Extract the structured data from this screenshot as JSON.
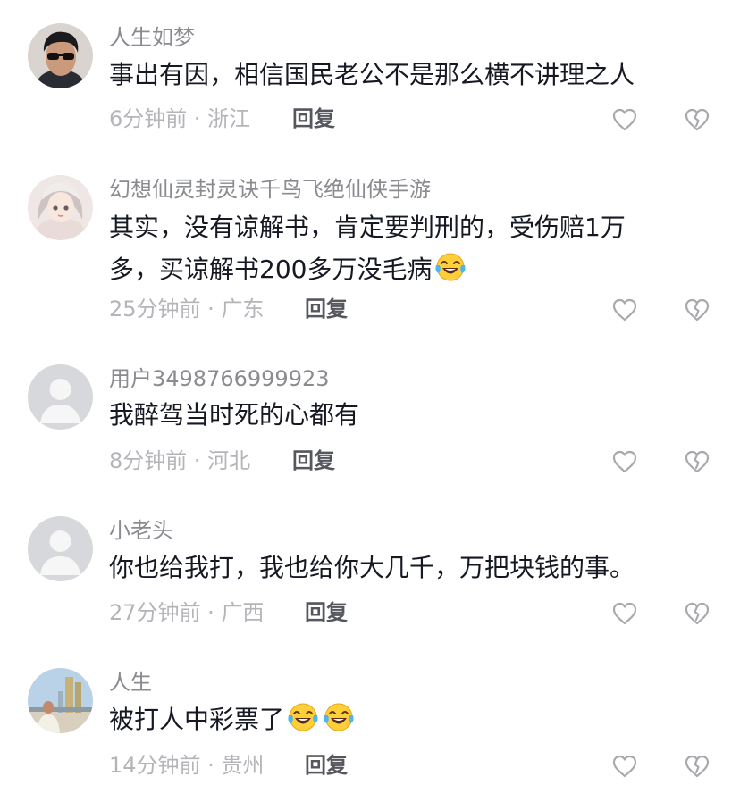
{
  "comments": [
    {
      "username": "人生如梦",
      "content": "事出有因，相信国民老公不是那么横不讲理之人",
      "time": "6分钟前",
      "location": "浙江",
      "reply_label": "回复",
      "avatar_icon": "man-sunglasses-avatar",
      "emojis": []
    },
    {
      "username": "幻想仙灵封灵诀千鸟飞绝仙侠手游",
      "content_line1": "其实，没有谅解书，肯定要判刑的，受伤赔1万",
      "content_line2": "多，买谅解书200多万没毛病",
      "time": "25分钟前",
      "location": "广东",
      "reply_label": "回复",
      "avatar_icon": "anime-girl-avatar",
      "emojis": [
        "laughing-tears-emoji"
      ]
    },
    {
      "username": "用户3498766999923",
      "content": "我醉驾当时死的心都有",
      "time": "8分钟前",
      "location": "河北",
      "reply_label": "回复",
      "avatar_icon": "default-user-avatar",
      "emojis": []
    },
    {
      "username": "小老头",
      "content": "你也给我打，我也给你大几千，万把块钱的事。",
      "time": "27分钟前",
      "location": "广西",
      "reply_label": "回复",
      "avatar_icon": "default-user-avatar",
      "emojis": []
    },
    {
      "username": "人生",
      "content": "被打人中彩票了",
      "time": "14分钟前",
      "location": "贵州",
      "reply_label": "回复",
      "avatar_icon": "city-photo-avatar",
      "emojis": [
        "laughing-tears-emoji",
        "laughing-tears-emoji"
      ]
    }
  ],
  "meta_separator": " · ",
  "icons": {
    "like": "heart-outline-icon",
    "dislike": "broken-heart-icon"
  },
  "colors": {
    "username": "#8a8b91",
    "content": "#161823",
    "meta": "#b4b5b9",
    "reply": "#56575e",
    "icon": "#a8a9ad"
  }
}
